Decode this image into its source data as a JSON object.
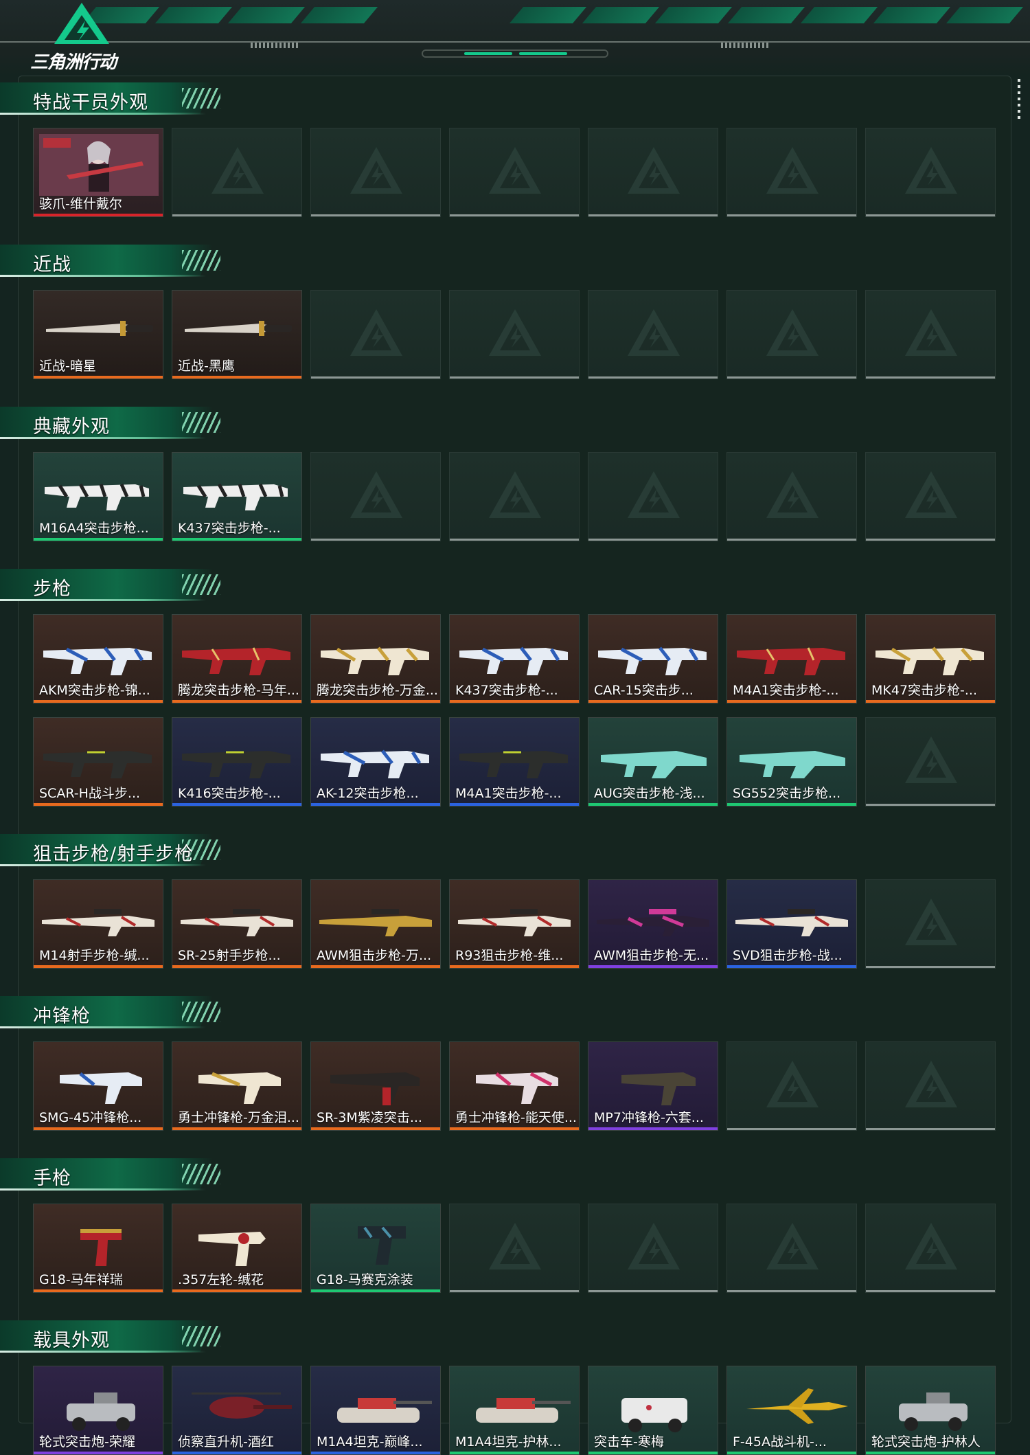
{
  "header": {
    "logo_text": "三角洲行动",
    "accent": "#14c98c"
  },
  "colors": {
    "red": "#d8242a",
    "orange": "#e86a1e",
    "green": "#1ec872",
    "blue": "#2b63e0",
    "purple": "#8040e0",
    "gray": "#8c9794"
  },
  "sections": [
    {
      "title": "特战干员外观",
      "rows": [
        [
          {
            "label": "骇爪-维什戴尔",
            "rarity": "red",
            "bg": "operator",
            "icon": "operator-portrait"
          }
        ]
      ]
    },
    {
      "title": "近战",
      "rows": [
        [
          {
            "label": "近战-暗星",
            "rarity": "orange",
            "bg": "dark",
            "icon": "knife"
          },
          {
            "label": "近战-黑鹰",
            "rarity": "orange",
            "bg": "dark",
            "icon": "knife"
          }
        ]
      ]
    },
    {
      "title": "典藏外观",
      "rows": [
        [
          {
            "label": "M16A4突击步枪...",
            "rarity": "green",
            "bg": "teal",
            "icon": "rifle-zebra"
          },
          {
            "label": "K437突击步枪-...",
            "rarity": "green",
            "bg": "teal",
            "icon": "rifle-zebra"
          }
        ]
      ]
    },
    {
      "title": "步枪",
      "rows": [
        [
          {
            "label": "AKM突击步枪-锦...",
            "rarity": "orange",
            "bg": "brown",
            "icon": "rifle-blue"
          },
          {
            "label": "腾龙突击步枪-马年...",
            "rarity": "orange",
            "bg": "brown",
            "icon": "rifle-red"
          },
          {
            "label": "腾龙突击步枪-万金...",
            "rarity": "orange",
            "bg": "brown",
            "icon": "rifle-gold"
          },
          {
            "label": "K437突击步枪-...",
            "rarity": "orange",
            "bg": "brown",
            "icon": "rifle-blue"
          },
          {
            "label": "CAR-15突击步...",
            "rarity": "orange",
            "bg": "brown",
            "icon": "rifle-blue"
          },
          {
            "label": "M4A1突击步枪-...",
            "rarity": "orange",
            "bg": "brown",
            "icon": "rifle-red"
          },
          {
            "label": "MK47突击步枪-...",
            "rarity": "orange",
            "bg": "brown",
            "icon": "rifle-gold"
          }
        ],
        [
          {
            "label": "SCAR-H战斗步...",
            "rarity": "orange",
            "bg": "brown",
            "icon": "rifle-dark"
          },
          {
            "label": "K416突击步枪-...",
            "rarity": "blue",
            "bg": "navy",
            "icon": "rifle-dark"
          },
          {
            "label": "AK-12突击步枪...",
            "rarity": "blue",
            "bg": "navy",
            "icon": "rifle-blue"
          },
          {
            "label": "M4A1突击步枪-...",
            "rarity": "blue",
            "bg": "navy",
            "icon": "rifle-dark"
          },
          {
            "label": "AUG突击步枪-浅...",
            "rarity": "green",
            "bg": "teal",
            "icon": "rifle-teal"
          },
          {
            "label": "SG552突击步枪...",
            "rarity": "green",
            "bg": "teal",
            "icon": "rifle-teal"
          }
        ]
      ]
    },
    {
      "title": "狙击步枪/射手步枪",
      "rows": [
        [
          {
            "label": "M14射手步枪-缄...",
            "rarity": "orange",
            "bg": "brown",
            "icon": "sniper-red"
          },
          {
            "label": "SR-25射手步枪...",
            "rarity": "orange",
            "bg": "brown",
            "icon": "sniper-red"
          },
          {
            "label": "AWM狙击步枪-万...",
            "rarity": "orange",
            "bg": "brown",
            "icon": "sniper-gold"
          },
          {
            "label": "R93狙击步枪-维...",
            "rarity": "orange",
            "bg": "brown",
            "icon": "sniper-red"
          },
          {
            "label": "AWM狙击步枪-无...",
            "rarity": "purple",
            "bg": "violet",
            "icon": "sniper-pink"
          },
          {
            "label": "SVD狙击步枪-战...",
            "rarity": "blue",
            "bg": "navy",
            "icon": "sniper-red"
          }
        ]
      ]
    },
    {
      "title": "冲锋枪",
      "rows": [
        [
          {
            "label": "SMG-45冲锋枪...",
            "rarity": "orange",
            "bg": "brown",
            "icon": "smg-blue"
          },
          {
            "label": "勇士冲锋枪-万金泪...",
            "rarity": "orange",
            "bg": "brown",
            "icon": "smg-gold"
          },
          {
            "label": "SR-3M紫凌突击...",
            "rarity": "orange",
            "bg": "brown",
            "icon": "smg-red"
          },
          {
            "label": "勇士冲锋枪-能天使...",
            "rarity": "orange",
            "bg": "brown",
            "icon": "smg-pink"
          },
          {
            "label": "MP7冲锋枪-六套...",
            "rarity": "purple",
            "bg": "violet",
            "icon": "smg-dark"
          }
        ]
      ]
    },
    {
      "title": "手枪",
      "rows": [
        [
          {
            "label": "G18-马年祥瑞",
            "rarity": "orange",
            "bg": "brown",
            "icon": "pistol-red"
          },
          {
            "label": ".357左轮-缄花",
            "rarity": "orange",
            "bg": "brown",
            "icon": "pistol-gold"
          },
          {
            "label": "G18-马赛克涂装",
            "rarity": "green",
            "bg": "teal",
            "icon": "pistol-dark"
          }
        ]
      ]
    },
    {
      "title": "载具外观",
      "rows": [
        [
          {
            "label": "轮式突击炮-荣耀",
            "rarity": "purple",
            "bg": "violet",
            "icon": "vehicle-buggy"
          },
          {
            "label": "侦察直升机-酒红",
            "rarity": "blue",
            "bg": "navy",
            "icon": "vehicle-heli"
          },
          {
            "label": "M1A4坦克-巅峰...",
            "rarity": "blue",
            "bg": "navy",
            "icon": "vehicle-tank"
          },
          {
            "label": "M1A4坦克-护林...",
            "rarity": "green",
            "bg": "teal",
            "icon": "vehicle-tank"
          },
          {
            "label": "突击车-寒梅",
            "rarity": "green",
            "bg": "teal",
            "icon": "vehicle-truck"
          },
          {
            "label": "F-45A战斗机-...",
            "rarity": "green",
            "bg": "teal",
            "icon": "vehicle-jet"
          },
          {
            "label": "轮式突击炮-护林人",
            "rarity": "green",
            "bg": "teal",
            "icon": "vehicle-buggy"
          }
        ]
      ]
    }
  ]
}
